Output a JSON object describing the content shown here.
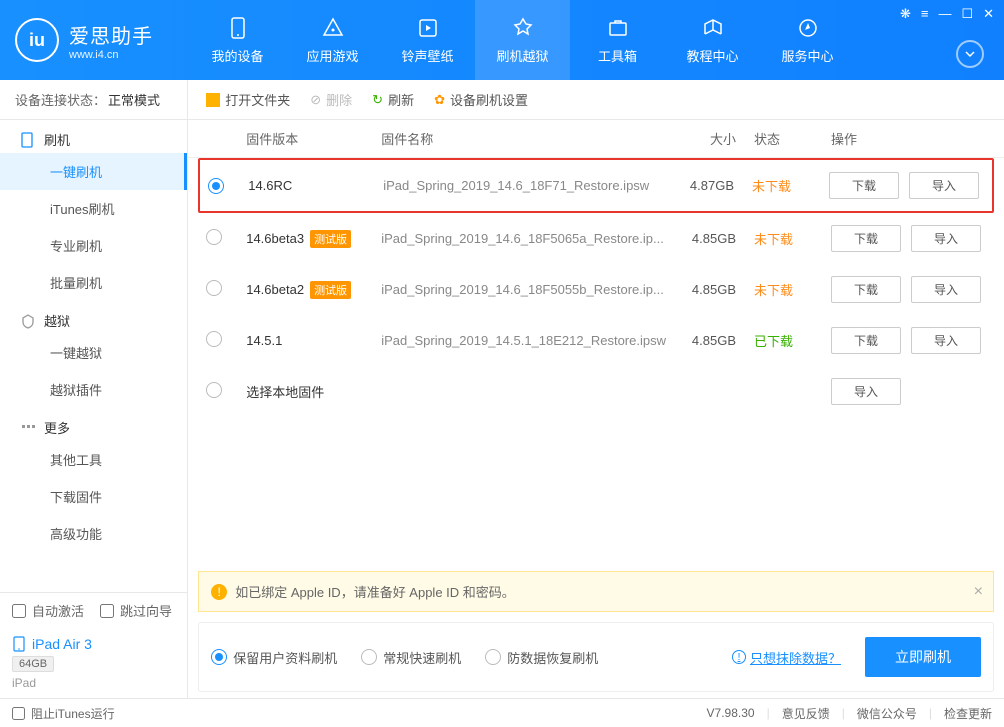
{
  "brand": {
    "title": "爱思助手",
    "sub": "www.i4.cn"
  },
  "nav": [
    {
      "label": "我的设备"
    },
    {
      "label": "应用游戏"
    },
    {
      "label": "铃声壁纸"
    },
    {
      "label": "刷机越狱"
    },
    {
      "label": "工具箱"
    },
    {
      "label": "教程中心"
    },
    {
      "label": "服务中心"
    }
  ],
  "sidebar": {
    "status_label": "设备连接状态：",
    "status_value": "正常模式",
    "groups": [
      {
        "title": "刷机",
        "items": [
          "一键刷机",
          "iTunes刷机",
          "专业刷机",
          "批量刷机"
        ]
      },
      {
        "title": "越狱",
        "items": [
          "一键越狱",
          "越狱插件"
        ]
      },
      {
        "title": "更多",
        "items": [
          "其他工具",
          "下载固件",
          "高级功能"
        ]
      }
    ],
    "auto_activate": "自动激活",
    "skip_guide": "跳过向导",
    "device": {
      "name": "iPad Air 3",
      "storage": "64GB",
      "type": "iPad"
    }
  },
  "toolbar": {
    "open": "打开文件夹",
    "delete": "删除",
    "refresh": "刷新",
    "settings": "设备刷机设置"
  },
  "table": {
    "headers": {
      "version": "固件版本",
      "name": "固件名称",
      "size": "大小",
      "status": "状态",
      "ops": "操作"
    },
    "rows": [
      {
        "selected": true,
        "version": "14.6RC",
        "badge": "",
        "name": "iPad_Spring_2019_14.6_18F71_Restore.ipsw",
        "size": "4.87GB",
        "status": "未下载",
        "status_cls": "st-orange",
        "download": true,
        "import": true
      },
      {
        "selected": false,
        "version": "14.6beta3",
        "badge": "测试版",
        "name": "iPad_Spring_2019_14.6_18F5065a_Restore.ip...",
        "size": "4.85GB",
        "status": "未下载",
        "status_cls": "st-orange",
        "download": true,
        "import": true
      },
      {
        "selected": false,
        "version": "14.6beta2",
        "badge": "测试版",
        "name": "iPad_Spring_2019_14.6_18F5055b_Restore.ip...",
        "size": "4.85GB",
        "status": "未下载",
        "status_cls": "st-orange",
        "download": true,
        "import": true
      },
      {
        "selected": false,
        "version": "14.5.1",
        "badge": "",
        "name": "iPad_Spring_2019_14.5.1_18E212_Restore.ipsw",
        "size": "4.85GB",
        "status": "已下载",
        "status_cls": "st-green",
        "download": true,
        "import": true
      },
      {
        "selected": false,
        "version": "选择本地固件",
        "badge": "",
        "name": "",
        "size": "",
        "status": "",
        "status_cls": "",
        "download": false,
        "import": true
      }
    ],
    "btn_download": "下载",
    "btn_import": "导入"
  },
  "warning": "如已绑定 Apple ID，请准备好 Apple ID 和密码。",
  "options": {
    "keep_data": "保留用户资料刷机",
    "normal": "常规快速刷机",
    "recovery": "防数据恢复刷机",
    "erase_link": "只想抹除数据？",
    "flash_btn": "立即刷机"
  },
  "footer": {
    "block_itunes": "阻止iTunes运行",
    "version": "V7.98.30",
    "feedback": "意见反馈",
    "wechat": "微信公众号",
    "update": "检查更新"
  }
}
